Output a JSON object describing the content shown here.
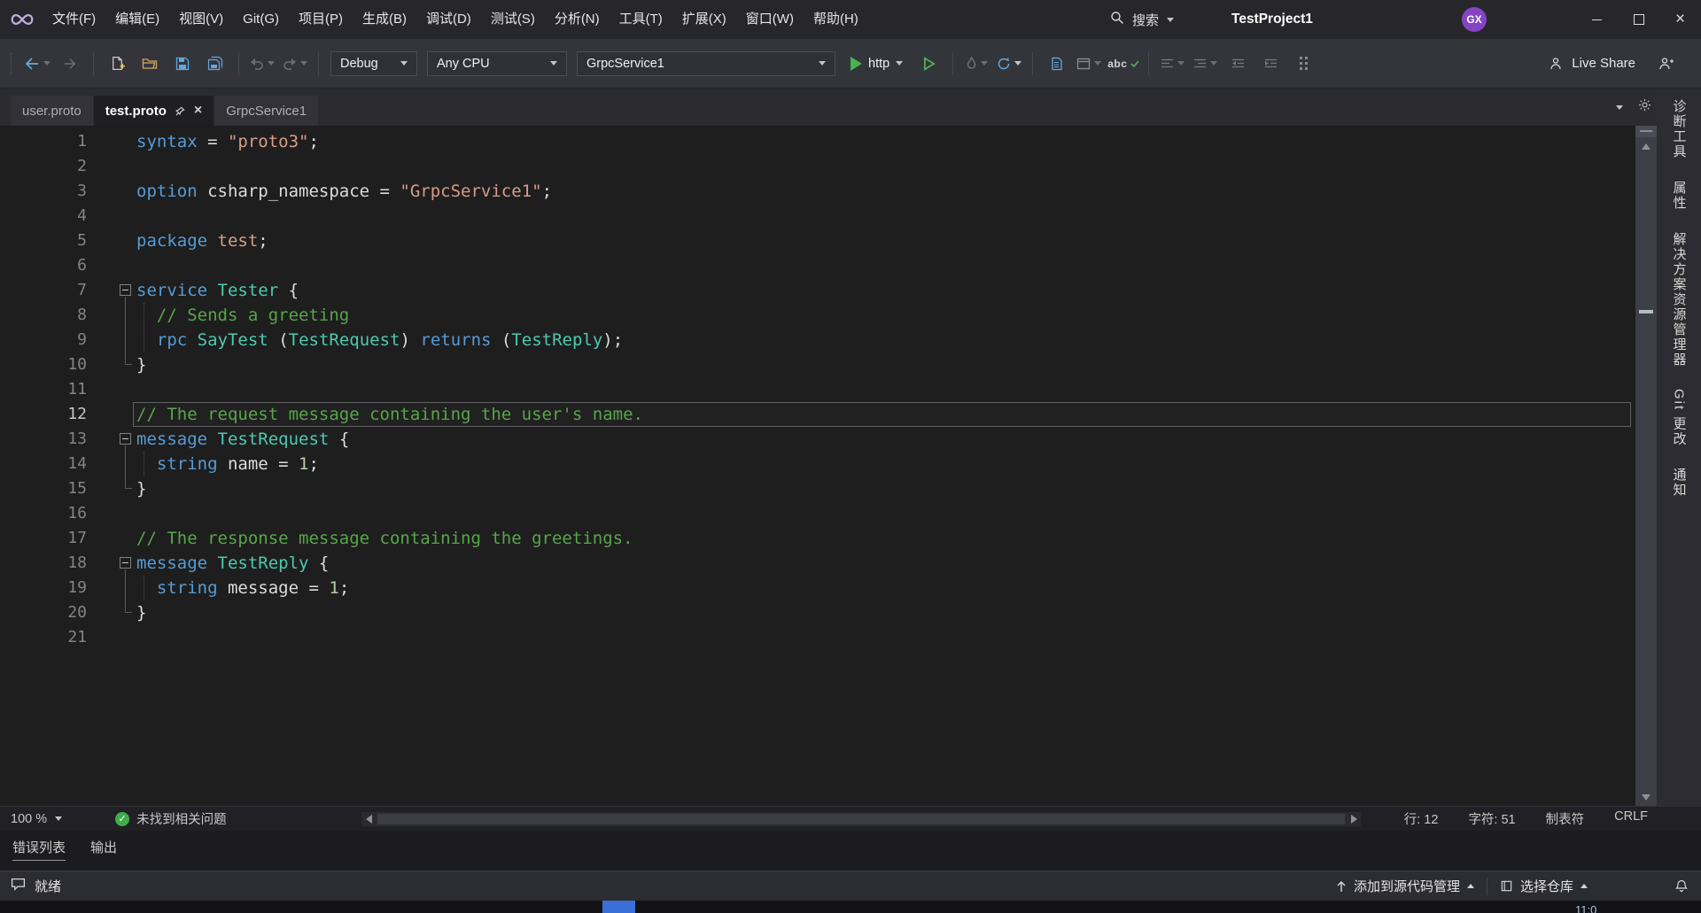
{
  "titlebar": {
    "menus": [
      "文件(F)",
      "编辑(E)",
      "视图(V)",
      "Git(G)",
      "项目(P)",
      "生成(B)",
      "调试(D)",
      "测试(S)",
      "分析(N)",
      "工具(T)",
      "扩展(X)",
      "窗口(W)",
      "帮助(H)"
    ],
    "search_label": "搜索",
    "project_title": "TestProject1",
    "avatar_initials": "GX"
  },
  "toolbar": {
    "config": "Debug",
    "platform": "Any CPU",
    "startup_project": "GrpcService1",
    "run_profile": "http",
    "spell_label": "abc",
    "live_share": "Live Share"
  },
  "tabstrip": {
    "tabs": [
      {
        "label": "user.proto",
        "active": false
      },
      {
        "label": "test.proto",
        "active": true
      },
      {
        "label": "GrpcService1",
        "active": false
      }
    ]
  },
  "side_tabs": [
    "诊断工具",
    "属性",
    "解决方案资源管理器",
    "Git 更改",
    "通知"
  ],
  "editor": {
    "language": "proto3",
    "current_line": 12,
    "lines": [
      {
        "n": 1,
        "segs": [
          [
            "kw",
            "syntax"
          ],
          [
            "pl",
            " = "
          ],
          [
            "str",
            "\"proto3\""
          ],
          [
            "pl",
            ";"
          ]
        ]
      },
      {
        "n": 2,
        "segs": []
      },
      {
        "n": 3,
        "segs": [
          [
            "kw",
            "option"
          ],
          [
            "pl",
            " csharp_namespace = "
          ],
          [
            "str",
            "\"GrpcService1\""
          ],
          [
            "pl",
            ";"
          ]
        ]
      },
      {
        "n": 4,
        "segs": []
      },
      {
        "n": 5,
        "segs": [
          [
            "kw",
            "package"
          ],
          [
            "pl",
            " "
          ],
          [
            "str",
            "test"
          ],
          [
            "pl",
            ";"
          ]
        ]
      },
      {
        "n": 6,
        "segs": []
      },
      {
        "n": 7,
        "fold": "start",
        "segs": [
          [
            "kw",
            "service"
          ],
          [
            "pl",
            " "
          ],
          [
            "typ",
            "Tester"
          ],
          [
            "pl",
            " {"
          ]
        ]
      },
      {
        "n": 8,
        "fold": "mid",
        "guide": true,
        "segs": [
          [
            "pl",
            "  "
          ],
          [
            "com",
            "// Sends a greeting"
          ]
        ]
      },
      {
        "n": 9,
        "fold": "mid",
        "guide": true,
        "segs": [
          [
            "pl",
            "  "
          ],
          [
            "kw",
            "rpc"
          ],
          [
            "pl",
            " "
          ],
          [
            "typ",
            "SayTest"
          ],
          [
            "pl",
            " ("
          ],
          [
            "typ",
            "TestRequest"
          ],
          [
            "pl",
            ") "
          ],
          [
            "kw",
            "returns"
          ],
          [
            "pl",
            " ("
          ],
          [
            "typ",
            "TestReply"
          ],
          [
            "pl",
            ");"
          ]
        ]
      },
      {
        "n": 10,
        "fold": "end",
        "segs": [
          [
            "pl",
            "}"
          ]
        ]
      },
      {
        "n": 11,
        "segs": []
      },
      {
        "n": 12,
        "current": true,
        "segs": [
          [
            "com",
            "// The request message containing the user's name."
          ]
        ]
      },
      {
        "n": 13,
        "fold": "start",
        "segs": [
          [
            "kw",
            "message"
          ],
          [
            "pl",
            " "
          ],
          [
            "typ",
            "TestRequest"
          ],
          [
            "pl",
            " {"
          ]
        ]
      },
      {
        "n": 14,
        "fold": "mid",
        "guide": true,
        "segs": [
          [
            "pl",
            "  "
          ],
          [
            "kw",
            "string"
          ],
          [
            "pl",
            " name = "
          ],
          [
            "num",
            "1"
          ],
          [
            "pl",
            ";"
          ]
        ]
      },
      {
        "n": 15,
        "fold": "end",
        "segs": [
          [
            "pl",
            "}"
          ]
        ]
      },
      {
        "n": 16,
        "segs": []
      },
      {
        "n": 17,
        "segs": [
          [
            "com",
            "// The response message containing the greetings."
          ]
        ]
      },
      {
        "n": 18,
        "fold": "start",
        "segs": [
          [
            "kw",
            "message"
          ],
          [
            "pl",
            " "
          ],
          [
            "typ",
            "TestReply"
          ],
          [
            "pl",
            " {"
          ]
        ]
      },
      {
        "n": 19,
        "fold": "mid",
        "guide": true,
        "segs": [
          [
            "pl",
            "  "
          ],
          [
            "kw",
            "string"
          ],
          [
            "pl",
            " message = "
          ],
          [
            "num",
            "1"
          ],
          [
            "pl",
            ";"
          ]
        ]
      },
      {
        "n": 20,
        "fold": "end",
        "segs": [
          [
            "pl",
            "}"
          ]
        ]
      },
      {
        "n": 21,
        "segs": []
      }
    ]
  },
  "editor_bar": {
    "zoom": "100 %",
    "health": "未找到相关问题",
    "line": "行: 12",
    "column": "字符: 51",
    "indent": "制表符",
    "eol": "CRLF"
  },
  "panel_tabs": [
    "错误列表",
    "输出"
  ],
  "statusbar": {
    "ready": "就绪",
    "add_to_source_control": "添加到源代码管理",
    "select_repo": "选择仓库"
  },
  "taskbar": {
    "clock": "11:0"
  },
  "colors": {
    "keyword": "#569cd6",
    "type": "#4ec9b0",
    "string": "#d69d85",
    "comment": "#57a64a",
    "plain": "#dcdcdc",
    "number": "#b5cea8",
    "editor_background": "#1e1e1e",
    "accent_green": "#3fae4a",
    "accent_blue": "#5fa8dc",
    "avatar_purple": "#8444c4",
    "taskbar_indicator_blue": "#3a6fd8"
  }
}
